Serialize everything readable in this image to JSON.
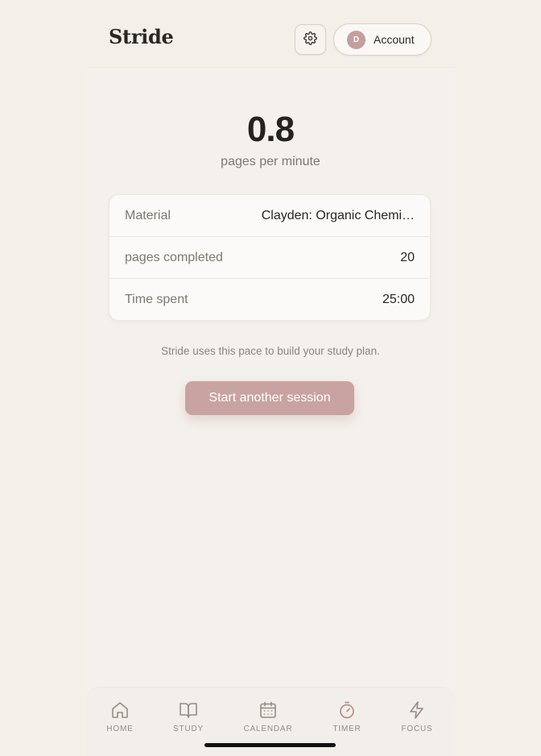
{
  "app": {
    "title": "Stride"
  },
  "header": {
    "account_label": "Account",
    "avatar_initial": "D"
  },
  "summary": {
    "pace_value": "0.8",
    "pace_unit": "pages per minute",
    "rows": [
      {
        "label": "Material",
        "value": "Clayden: Organic Chemi…"
      },
      {
        "label": "pages completed",
        "value": "20"
      },
      {
        "label": "Time spent",
        "value": "25:00"
      }
    ],
    "note": "Stride uses this pace to build your study plan.",
    "cta_label": "Start another session"
  },
  "tabbar": {
    "items": [
      {
        "label": "HOME",
        "icon": "home-icon"
      },
      {
        "label": "STUDY",
        "icon": "book-icon"
      },
      {
        "label": "CALENDAR",
        "icon": "calendar-icon"
      },
      {
        "label": "TIMER",
        "icon": "stopwatch-icon",
        "active": true
      },
      {
        "label": "FOCUS",
        "icon": "lightning-icon"
      }
    ]
  },
  "colors": {
    "background": "#f3f0ea",
    "accent": "#c9a3a1",
    "active_tab_icon": "#b98e8c",
    "text_primary": "#26221e",
    "text_muted": "#7f7871"
  }
}
